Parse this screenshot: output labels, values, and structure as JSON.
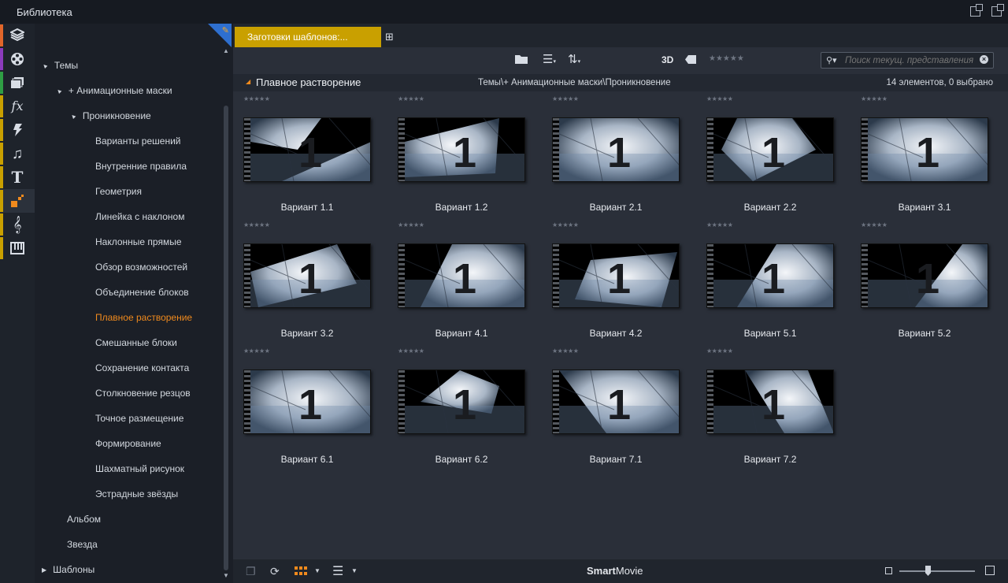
{
  "window": {
    "title": "Библиотека"
  },
  "strip": {
    "items": [
      {
        "name": "box-icon",
        "bar": "#e2662a"
      },
      {
        "name": "film-reel-icon",
        "bar": "#8c3bbd"
      },
      {
        "name": "photo-stack-icon",
        "bar": "#2f9e44"
      },
      {
        "name": "fx-icon",
        "bar": "#c9a000"
      },
      {
        "name": "lightning-icon",
        "bar": "#c9a000"
      },
      {
        "name": "music-note-icon",
        "bar": "#c9a000"
      },
      {
        "name": "title-t-icon",
        "bar": "#c9a000"
      },
      {
        "name": "montage-icon",
        "bar": "#c9a000"
      },
      {
        "name": "treble-clef-icon",
        "bar": "#c9a000"
      },
      {
        "name": "piano-icon",
        "bar": "#c9a000"
      }
    ]
  },
  "tree": {
    "items": [
      {
        "label": "Темы",
        "level": 0,
        "expanded": true,
        "toggle": "▲"
      },
      {
        "label": "+ Анимационные маски",
        "level": 1,
        "expanded": true,
        "toggle": "▲"
      },
      {
        "label": "Проникновение",
        "level": 2,
        "expanded": true,
        "toggle": "▲"
      },
      {
        "label": "Варианты решений",
        "level": 3
      },
      {
        "label": "Внутренние правила",
        "level": 3
      },
      {
        "label": "Геометрия",
        "level": 3
      },
      {
        "label": "Линейка с наклоном",
        "level": 3
      },
      {
        "label": "Наклонные прямые",
        "level": 3
      },
      {
        "label": "Обзор возможностей",
        "level": 3
      },
      {
        "label": "Объединение блоков",
        "level": 3
      },
      {
        "label": "Плавное растворение",
        "level": 3,
        "selected": true
      },
      {
        "label": "Смешанные блоки",
        "level": 3
      },
      {
        "label": "Сохранение контакта",
        "level": 3
      },
      {
        "label": "Столкновение резцов",
        "level": 3
      },
      {
        "label": "Точное размещение",
        "level": 3
      },
      {
        "label": "Формирование",
        "level": 3
      },
      {
        "label": "Шахматный рисунок",
        "level": 3
      },
      {
        "label": "Эстрадные звёзды",
        "level": 3
      },
      {
        "label": "Альбом",
        "level": 1
      },
      {
        "label": "Звезда",
        "level": 1
      },
      {
        "label": "Шаблоны",
        "level": 0,
        "toggle": "▶"
      }
    ]
  },
  "tabs": {
    "active_label": "Заготовки шаблонов:..."
  },
  "toolbar": {
    "three_d": "3D",
    "rating_stars": "★★★★★"
  },
  "search": {
    "placeholder": "Поиск текущ. представления",
    "value": ""
  },
  "pathbar": {
    "title": "Плавное растворение",
    "path": "Темы\\+ Анимационные маски\\Проникновение",
    "count": "14 элементов, 0 выбрано"
  },
  "grid": {
    "stars": "★★★★★",
    "items": [
      {
        "label": "Вариант 1.1"
      },
      {
        "label": "Вариант 1.2"
      },
      {
        "label": "Вариант 2.1"
      },
      {
        "label": "Вариант 2.2"
      },
      {
        "label": "Вариант 3.1"
      },
      {
        "label": "Вариант 3.2"
      },
      {
        "label": "Вариант 4.1"
      },
      {
        "label": "Вариант 4.2"
      },
      {
        "label": "Вариант 5.1"
      },
      {
        "label": "Вариант 5.2"
      },
      {
        "label": "Вариант 6.1"
      },
      {
        "label": "Вариант 6.2"
      },
      {
        "label": "Вариант 7.1"
      },
      {
        "label": "Вариант 7.2"
      }
    ]
  },
  "bottombar": {
    "brand_bold": "Smart",
    "brand_rest": "Movie"
  },
  "colors": {
    "accent": "#f08a1d",
    "tab": "#c9a000",
    "corner": "#2e6fcf"
  }
}
